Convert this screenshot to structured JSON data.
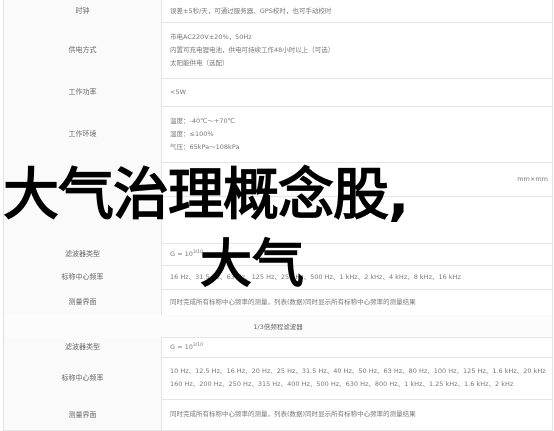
{
  "rows": [
    {
      "label": "时钟",
      "lines": [
        "误差±5秒/天，可通过服务器、GPS校时，也可手动校时"
      ]
    },
    {
      "label": "供电方式",
      "lines": [
        "市电AC220V±20%，50Hz",
        "内置可充电锂电池，供电可持续工作48小时以上（可选）",
        "太阳能供电（选配）"
      ]
    },
    {
      "label": "工作功率",
      "lines": [
        "<5W"
      ]
    },
    {
      "label": "工作环境",
      "lines": [
        "温度：-40℃～+70℃",
        "湿度：≤100%",
        "气压：65kPa～108kPa"
      ]
    },
    {
      "label": "",
      "lines": [
        "mm×mm"
      ]
    },
    {
      "label": "",
      "lines": [
        ""
      ]
    },
    {
      "label": "滤波器类型",
      "value_prefix": "G = 10",
      "value_sup": "3/10"
    },
    {
      "label": "标称中心频率",
      "lines": [
        "16 Hz、31.5 Hz、63 Hz、125 Hz、250 Hz、500 Hz、1 kHz、2 kHz、4 kHz、8 kHz、16 kHz"
      ]
    },
    {
      "label": "测量界面",
      "lines": [
        "同时完成所有标称中心频率的测量，列表(数据)同时显示所有标称中心频率的测量结果"
      ]
    },
    {
      "section": "1/3倍频程滤波器"
    },
    {
      "label": "滤波器类型",
      "value_prefix": "G = 10",
      "value_sup": "3/10"
    },
    {
      "label": "标称中心频率",
      "lines": [
        "10 Hz、12.5 Hz、16 Hz、20 Hz、25 Hz、31.5 Hz、40 Hz、50 Hz、63 Hz、80 Hz、100 Hz、125 Hz、1.6 kHz、20 kHz",
        "160 Hz、200 Hz、250 Hz、315 Hz、400 Hz、500 Hz、630 Hz、800 Hz、1 kHz、1.25 kHz、1.6 kHz、2 kHz"
      ]
    },
    {
      "label": "测量界面",
      "lines": [
        "同时完成所有标称中心频率的测量，列表(数据)同时显示所有标称中心频率的测量结果"
      ]
    }
  ],
  "overlay": {
    "line1": "大气治理概念股,",
    "line2": "大气"
  }
}
